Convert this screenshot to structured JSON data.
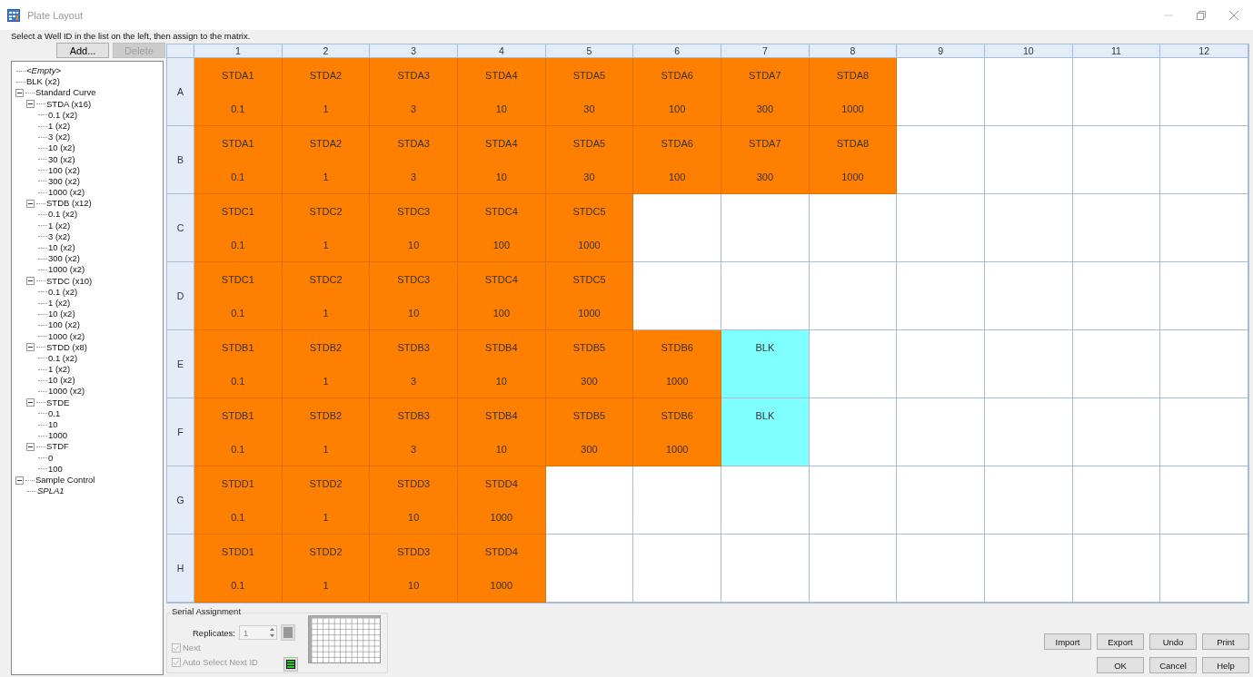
{
  "window": {
    "title": "Plate Layout"
  },
  "instruction": "Select a Well ID in the list on the left, then assign to the matrix.",
  "tree_buttons": [
    {
      "label": "Add...",
      "disabled": false
    },
    {
      "label": "Delete",
      "disabled": true
    }
  ],
  "tree": [
    {
      "label": "<Empty>",
      "kind": "placeholder"
    },
    {
      "label": "BLK (x2)",
      "kind": "item"
    },
    {
      "label": "Standard Curve",
      "kind": "item",
      "expanded": true,
      "children": [
        {
          "label": "STDA (x16)",
          "kind": "item",
          "expanded": true,
          "children": [
            {
              "label": "0.1 (x2)",
              "kind": "item"
            },
            {
              "label": "1 (x2)",
              "kind": "item"
            },
            {
              "label": "3 (x2)",
              "kind": "item"
            },
            {
              "label": "10 (x2)",
              "kind": "item"
            },
            {
              "label": "30 (x2)",
              "kind": "item"
            },
            {
              "label": "100 (x2)",
              "kind": "item"
            },
            {
              "label": "300 (x2)",
              "kind": "item"
            },
            {
              "label": "1000 (x2)",
              "kind": "item"
            }
          ]
        },
        {
          "label": "STDB (x12)",
          "kind": "item",
          "expanded": true,
          "children": [
            {
              "label": "0.1 (x2)",
              "kind": "item"
            },
            {
              "label": "1 (x2)",
              "kind": "item"
            },
            {
              "label": "3 (x2)",
              "kind": "item"
            },
            {
              "label": "10 (x2)",
              "kind": "item"
            },
            {
              "label": "300 (x2)",
              "kind": "item"
            },
            {
              "label": "1000 (x2)",
              "kind": "item"
            }
          ]
        },
        {
          "label": "STDC (x10)",
          "kind": "item",
          "expanded": true,
          "children": [
            {
              "label": "0.1 (x2)",
              "kind": "item"
            },
            {
              "label": "1 (x2)",
              "kind": "item"
            },
            {
              "label": "10 (x2)",
              "kind": "item"
            },
            {
              "label": "100 (x2)",
              "kind": "item"
            },
            {
              "label": "1000 (x2)",
              "kind": "item"
            }
          ]
        },
        {
          "label": "STDD (x8)",
          "kind": "item",
          "expanded": true,
          "children": [
            {
              "label": "0.1 (x2)",
              "kind": "item"
            },
            {
              "label": "1 (x2)",
              "kind": "item"
            },
            {
              "label": "10 (x2)",
              "kind": "item"
            },
            {
              "label": "1000 (x2)",
              "kind": "item"
            }
          ]
        },
        {
          "label": "STDE",
          "kind": "item",
          "expanded": true,
          "children": [
            {
              "label": "0.1",
              "kind": "item"
            },
            {
              "label": "10",
              "kind": "item"
            },
            {
              "label": "1000",
              "kind": "item"
            }
          ]
        },
        {
          "label": "STDF",
          "kind": "item",
          "expanded": true,
          "children": [
            {
              "label": "0",
              "kind": "item"
            },
            {
              "label": "100",
              "kind": "item"
            }
          ]
        }
      ]
    },
    {
      "label": "Sample Control",
      "kind": "item",
      "expanded": true,
      "children": [
        {
          "label": "SPLA1",
          "kind": "placeholder"
        }
      ]
    }
  ],
  "plate": {
    "columns": [
      "1",
      "2",
      "3",
      "4",
      "5",
      "6",
      "7",
      "8",
      "9",
      "10",
      "11",
      "12"
    ],
    "rows": [
      {
        "label": "A",
        "wells": [
          {
            "kind": "standard",
            "name": "STDA1",
            "value": "0.1"
          },
          {
            "kind": "standard",
            "name": "STDA2",
            "value": "1"
          },
          {
            "kind": "standard",
            "name": "STDA3",
            "value": "3"
          },
          {
            "kind": "standard",
            "name": "STDA4",
            "value": "10"
          },
          {
            "kind": "standard",
            "name": "STDA5",
            "value": "30"
          },
          {
            "kind": "standard",
            "name": "STDA6",
            "value": "100"
          },
          {
            "kind": "standard",
            "name": "STDA7",
            "value": "300"
          },
          {
            "kind": "standard",
            "name": "STDA8",
            "value": "1000"
          },
          {
            "kind": "empty"
          },
          {
            "kind": "empty"
          },
          {
            "kind": "empty"
          },
          {
            "kind": "empty"
          }
        ]
      },
      {
        "label": "B",
        "wells": [
          {
            "kind": "standard",
            "name": "STDA1",
            "value": "0.1"
          },
          {
            "kind": "standard",
            "name": "STDA2",
            "value": "1"
          },
          {
            "kind": "standard",
            "name": "STDA3",
            "value": "3"
          },
          {
            "kind": "standard",
            "name": "STDA4",
            "value": "10"
          },
          {
            "kind": "standard",
            "name": "STDA5",
            "value": "30"
          },
          {
            "kind": "standard",
            "name": "STDA6",
            "value": "100"
          },
          {
            "kind": "standard",
            "name": "STDA7",
            "value": "300"
          },
          {
            "kind": "standard",
            "name": "STDA8",
            "value": "1000"
          },
          {
            "kind": "empty"
          },
          {
            "kind": "empty"
          },
          {
            "kind": "empty"
          },
          {
            "kind": "empty"
          }
        ]
      },
      {
        "label": "C",
        "wells": [
          {
            "kind": "standard",
            "name": "STDC1",
            "value": "0.1"
          },
          {
            "kind": "standard",
            "name": "STDC2",
            "value": "1"
          },
          {
            "kind": "standard",
            "name": "STDC3",
            "value": "10"
          },
          {
            "kind": "standard",
            "name": "STDC4",
            "value": "100"
          },
          {
            "kind": "standard",
            "name": "STDC5",
            "value": "1000"
          },
          {
            "kind": "empty"
          },
          {
            "kind": "empty"
          },
          {
            "kind": "empty"
          },
          {
            "kind": "empty"
          },
          {
            "kind": "empty"
          },
          {
            "kind": "empty"
          },
          {
            "kind": "empty"
          }
        ]
      },
      {
        "label": "D",
        "wells": [
          {
            "kind": "standard",
            "name": "STDC1",
            "value": "0.1"
          },
          {
            "kind": "standard",
            "name": "STDC2",
            "value": "1"
          },
          {
            "kind": "standard",
            "name": "STDC3",
            "value": "10"
          },
          {
            "kind": "standard",
            "name": "STDC4",
            "value": "100"
          },
          {
            "kind": "standard",
            "name": "STDC5",
            "value": "1000"
          },
          {
            "kind": "empty"
          },
          {
            "kind": "empty"
          },
          {
            "kind": "empty"
          },
          {
            "kind": "empty"
          },
          {
            "kind": "empty"
          },
          {
            "kind": "empty"
          },
          {
            "kind": "empty"
          }
        ]
      },
      {
        "label": "E",
        "wells": [
          {
            "kind": "standard",
            "name": "STDB1",
            "value": "0.1"
          },
          {
            "kind": "standard",
            "name": "STDB2",
            "value": "1"
          },
          {
            "kind": "standard",
            "name": "STDB3",
            "value": "3"
          },
          {
            "kind": "standard",
            "name": "STDB4",
            "value": "10"
          },
          {
            "kind": "standard",
            "name": "STDB5",
            "value": "300"
          },
          {
            "kind": "standard",
            "name": "STDB6",
            "value": "1000"
          },
          {
            "kind": "blank",
            "name": "BLK"
          },
          {
            "kind": "empty"
          },
          {
            "kind": "empty"
          },
          {
            "kind": "empty"
          },
          {
            "kind": "empty"
          },
          {
            "kind": "empty"
          }
        ]
      },
      {
        "label": "F",
        "wells": [
          {
            "kind": "standard",
            "name": "STDB1",
            "value": "0.1"
          },
          {
            "kind": "standard",
            "name": "STDB2",
            "value": "1"
          },
          {
            "kind": "standard",
            "name": "STDB3",
            "value": "3"
          },
          {
            "kind": "standard",
            "name": "STDB4",
            "value": "10"
          },
          {
            "kind": "standard",
            "name": "STDB5",
            "value": "300"
          },
          {
            "kind": "standard",
            "name": "STDB6",
            "value": "1000"
          },
          {
            "kind": "blank",
            "name": "BLK"
          },
          {
            "kind": "empty"
          },
          {
            "kind": "empty"
          },
          {
            "kind": "empty"
          },
          {
            "kind": "empty"
          },
          {
            "kind": "empty"
          }
        ]
      },
      {
        "label": "G",
        "wells": [
          {
            "kind": "standard",
            "name": "STDD1",
            "value": "0.1"
          },
          {
            "kind": "standard",
            "name": "STDD2",
            "value": "1"
          },
          {
            "kind": "standard",
            "name": "STDD3",
            "value": "10"
          },
          {
            "kind": "standard",
            "name": "STDD4",
            "value": "1000"
          },
          {
            "kind": "empty"
          },
          {
            "kind": "empty"
          },
          {
            "kind": "empty"
          },
          {
            "kind": "empty"
          },
          {
            "kind": "empty"
          },
          {
            "kind": "empty"
          },
          {
            "kind": "empty"
          },
          {
            "kind": "empty"
          }
        ]
      },
      {
        "label": "H",
        "wells": [
          {
            "kind": "standard",
            "name": "STDD1",
            "value": "0.1"
          },
          {
            "kind": "standard",
            "name": "STDD2",
            "value": "1"
          },
          {
            "kind": "standard",
            "name": "STDD3",
            "value": "10"
          },
          {
            "kind": "standard",
            "name": "STDD4",
            "value": "1000"
          },
          {
            "kind": "empty"
          },
          {
            "kind": "empty"
          },
          {
            "kind": "empty"
          },
          {
            "kind": "empty"
          },
          {
            "kind": "empty"
          },
          {
            "kind": "empty"
          },
          {
            "kind": "empty"
          },
          {
            "kind": "empty"
          }
        ]
      }
    ]
  },
  "serial_assignment": {
    "title": "Serial Assignment",
    "replicates_label": "Replicates:",
    "replicates": "1",
    "options": [
      {
        "label": "Next",
        "checked": true,
        "disabled": true
      },
      {
        "label": "Auto Select Next ID",
        "checked": true,
        "disabled": true
      }
    ]
  },
  "button_rows": [
    {
      "buttons": [
        "Import",
        "Export",
        "Undo",
        "Print"
      ]
    },
    {
      "buttons": [
        "OK",
        "Cancel",
        "Help"
      ]
    }
  ]
}
